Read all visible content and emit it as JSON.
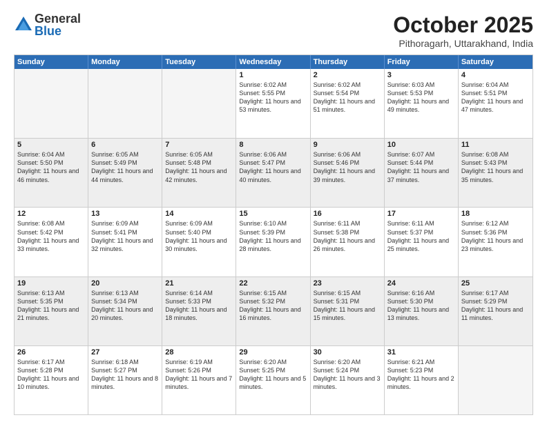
{
  "header": {
    "logo_general": "General",
    "logo_blue": "Blue",
    "title": "October 2025",
    "location": "Pithoragarh, Uttarakhand, India"
  },
  "weekdays": [
    "Sunday",
    "Monday",
    "Tuesday",
    "Wednesday",
    "Thursday",
    "Friday",
    "Saturday"
  ],
  "rows": [
    [
      {
        "day": "",
        "info": "",
        "empty": true
      },
      {
        "day": "",
        "info": "",
        "empty": true
      },
      {
        "day": "",
        "info": "",
        "empty": true
      },
      {
        "day": "1",
        "info": "Sunrise: 6:02 AM\nSunset: 5:55 PM\nDaylight: 11 hours and 53 minutes."
      },
      {
        "day": "2",
        "info": "Sunrise: 6:02 AM\nSunset: 5:54 PM\nDaylight: 11 hours and 51 minutes."
      },
      {
        "day": "3",
        "info": "Sunrise: 6:03 AM\nSunset: 5:53 PM\nDaylight: 11 hours and 49 minutes."
      },
      {
        "day": "4",
        "info": "Sunrise: 6:04 AM\nSunset: 5:51 PM\nDaylight: 11 hours and 47 minutes."
      }
    ],
    [
      {
        "day": "5",
        "info": "Sunrise: 6:04 AM\nSunset: 5:50 PM\nDaylight: 11 hours and 46 minutes.",
        "shaded": true
      },
      {
        "day": "6",
        "info": "Sunrise: 6:05 AM\nSunset: 5:49 PM\nDaylight: 11 hours and 44 minutes.",
        "shaded": true
      },
      {
        "day": "7",
        "info": "Sunrise: 6:05 AM\nSunset: 5:48 PM\nDaylight: 11 hours and 42 minutes.",
        "shaded": true
      },
      {
        "day": "8",
        "info": "Sunrise: 6:06 AM\nSunset: 5:47 PM\nDaylight: 11 hours and 40 minutes.",
        "shaded": true
      },
      {
        "day": "9",
        "info": "Sunrise: 6:06 AM\nSunset: 5:46 PM\nDaylight: 11 hours and 39 minutes.",
        "shaded": true
      },
      {
        "day": "10",
        "info": "Sunrise: 6:07 AM\nSunset: 5:44 PM\nDaylight: 11 hours and 37 minutes.",
        "shaded": true
      },
      {
        "day": "11",
        "info": "Sunrise: 6:08 AM\nSunset: 5:43 PM\nDaylight: 11 hours and 35 minutes.",
        "shaded": true
      }
    ],
    [
      {
        "day": "12",
        "info": "Sunrise: 6:08 AM\nSunset: 5:42 PM\nDaylight: 11 hours and 33 minutes."
      },
      {
        "day": "13",
        "info": "Sunrise: 6:09 AM\nSunset: 5:41 PM\nDaylight: 11 hours and 32 minutes."
      },
      {
        "day": "14",
        "info": "Sunrise: 6:09 AM\nSunset: 5:40 PM\nDaylight: 11 hours and 30 minutes."
      },
      {
        "day": "15",
        "info": "Sunrise: 6:10 AM\nSunset: 5:39 PM\nDaylight: 11 hours and 28 minutes."
      },
      {
        "day": "16",
        "info": "Sunrise: 6:11 AM\nSunset: 5:38 PM\nDaylight: 11 hours and 26 minutes."
      },
      {
        "day": "17",
        "info": "Sunrise: 6:11 AM\nSunset: 5:37 PM\nDaylight: 11 hours and 25 minutes."
      },
      {
        "day": "18",
        "info": "Sunrise: 6:12 AM\nSunset: 5:36 PM\nDaylight: 11 hours and 23 minutes."
      }
    ],
    [
      {
        "day": "19",
        "info": "Sunrise: 6:13 AM\nSunset: 5:35 PM\nDaylight: 11 hours and 21 minutes.",
        "shaded": true
      },
      {
        "day": "20",
        "info": "Sunrise: 6:13 AM\nSunset: 5:34 PM\nDaylight: 11 hours and 20 minutes.",
        "shaded": true
      },
      {
        "day": "21",
        "info": "Sunrise: 6:14 AM\nSunset: 5:33 PM\nDaylight: 11 hours and 18 minutes.",
        "shaded": true
      },
      {
        "day": "22",
        "info": "Sunrise: 6:15 AM\nSunset: 5:32 PM\nDaylight: 11 hours and 16 minutes.",
        "shaded": true
      },
      {
        "day": "23",
        "info": "Sunrise: 6:15 AM\nSunset: 5:31 PM\nDaylight: 11 hours and 15 minutes.",
        "shaded": true
      },
      {
        "day": "24",
        "info": "Sunrise: 6:16 AM\nSunset: 5:30 PM\nDaylight: 11 hours and 13 minutes.",
        "shaded": true
      },
      {
        "day": "25",
        "info": "Sunrise: 6:17 AM\nSunset: 5:29 PM\nDaylight: 11 hours and 11 minutes.",
        "shaded": true
      }
    ],
    [
      {
        "day": "26",
        "info": "Sunrise: 6:17 AM\nSunset: 5:28 PM\nDaylight: 11 hours and 10 minutes."
      },
      {
        "day": "27",
        "info": "Sunrise: 6:18 AM\nSunset: 5:27 PM\nDaylight: 11 hours and 8 minutes."
      },
      {
        "day": "28",
        "info": "Sunrise: 6:19 AM\nSunset: 5:26 PM\nDaylight: 11 hours and 7 minutes."
      },
      {
        "day": "29",
        "info": "Sunrise: 6:20 AM\nSunset: 5:25 PM\nDaylight: 11 hours and 5 minutes."
      },
      {
        "day": "30",
        "info": "Sunrise: 6:20 AM\nSunset: 5:24 PM\nDaylight: 11 hours and 3 minutes."
      },
      {
        "day": "31",
        "info": "Sunrise: 6:21 AM\nSunset: 5:23 PM\nDaylight: 11 hours and 2 minutes."
      },
      {
        "day": "",
        "info": "",
        "empty": true
      }
    ]
  ]
}
